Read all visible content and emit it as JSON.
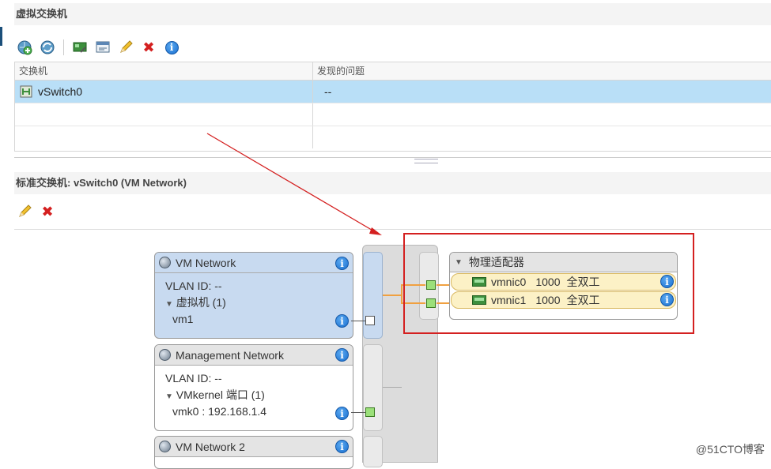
{
  "switches_section": {
    "title": "虚拟交换机",
    "columns": [
      "交换机",
      "发现的问题"
    ],
    "rows": [
      {
        "name": "vSwitch0",
        "issues": "--",
        "selected": true
      },
      {
        "name": "",
        "issues": ""
      },
      {
        "name": "",
        "issues": ""
      }
    ]
  },
  "detail_section": {
    "title": "标准交换机: vSwitch0 (VM Network)"
  },
  "port_groups": [
    {
      "name": "VM Network",
      "vlan": "VLAN ID: --",
      "group_label": "虚拟机 (1)",
      "member": "vm1",
      "highlighted": true
    },
    {
      "name": "Management Network",
      "vlan": "VLAN ID: --",
      "group_label": "VMkernel 端口 (1)",
      "member": "vmk0 : 192.168.1.4",
      "highlighted": false
    },
    {
      "name": "VM Network 2",
      "highlighted": false
    }
  ],
  "physical_adapters": {
    "title": "物理适配器",
    "nics": [
      {
        "name": "vmnic0",
        "speed": "1000",
        "duplex": "全双工"
      },
      {
        "name": "vmnic1",
        "speed": "1000",
        "duplex": "全双工"
      }
    ]
  },
  "watermark": "@51CTO博客",
  "colors": {
    "selection": "#b9dff7",
    "highlight": "#c8daf0",
    "annotation_red": "#d42020",
    "uplink_orange": "#f0a040",
    "nic_fill": "#fcf1c6"
  },
  "icons": {
    "toolbar_top": [
      "add-network-icon",
      "refresh-network-icon",
      "manage-adapters-icon",
      "migrate-adapter-icon",
      "edit-pencil-icon",
      "delete-x-icon",
      "info-icon"
    ],
    "toolbar_detail": [
      "edit-pencil-icon",
      "delete-x-icon"
    ]
  }
}
